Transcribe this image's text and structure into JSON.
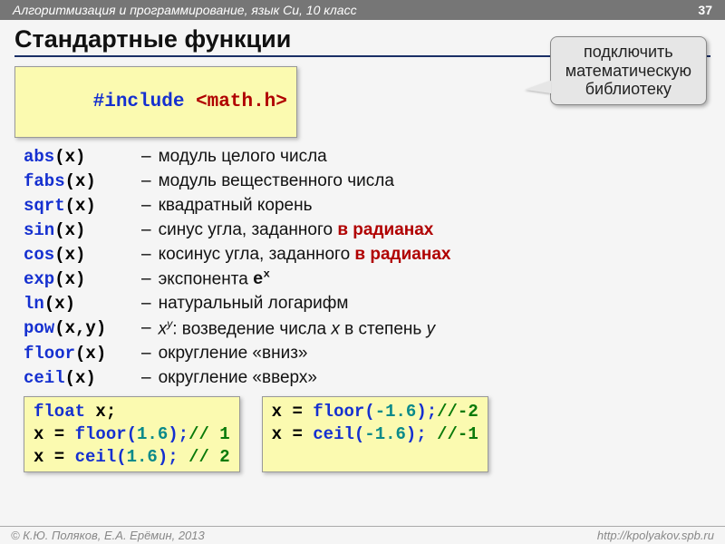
{
  "header": {
    "course": "Алгоритмизация и программирование, язык Си, 10 класс",
    "page": "37"
  },
  "title": "Стандартные функции",
  "include": {
    "directive": "#include",
    "header": "<math.h>"
  },
  "callout": {
    "l1": "подключить",
    "l2": "математическую",
    "l3": "библиотеку"
  },
  "funcs": [
    {
      "name": "abs",
      "args": "(x)",
      "desc": "модуль целого числа"
    },
    {
      "name": "fabs",
      "args": "(x)",
      "desc": "модуль вещественного числа"
    },
    {
      "name": "sqrt",
      "args": "(x)",
      "desc": "квадратный корень"
    },
    {
      "name": "sin",
      "args": "(x)",
      "desc_pre": "синус угла, заданного ",
      "em": "в радианах"
    },
    {
      "name": "cos",
      "args": "(x)",
      "desc_pre": "косинус угла, заданного ",
      "em": "в радианах"
    },
    {
      "name": "exp",
      "args": "(x)",
      "desc_pre": "экспонента ",
      "mono": "e",
      "sup": "x"
    },
    {
      "name": "ln",
      "args": "(x)",
      "desc": "натуральный логарифм"
    },
    {
      "name": "pow",
      "args": "(x,y)",
      "it1": "x",
      "sup": "y",
      "desc_post": ": возведение числа ",
      "it2": "x",
      "desc_post2": " в степень ",
      "it3": "y"
    },
    {
      "name": "floor",
      "args": "(x)",
      "desc": "округление «вниз»"
    },
    {
      "name": "ceil",
      "args": "(x)",
      "desc": "округление «вверх»"
    }
  ],
  "ex1": {
    "l1a": "float",
    "l1b": " x;",
    "l2a": "x = ",
    "l2b": "floor(",
    "l2c": "1.6",
    "l2d": ");",
    "l2e": "// 1",
    "l3a": "x = ",
    "l3b": "ceil(",
    "l3c": "1.6",
    "l3d": "); ",
    "l3e": "// 2"
  },
  "ex2": {
    "l2a": "x = ",
    "l2b": "floor(",
    "l2c": "-1.6",
    "l2d": ");",
    "l2e": "//-2",
    "l3a": "x = ",
    "l3b": "ceil(",
    "l3c": "-1.6",
    "l3d": "); ",
    "l3e": "//-1"
  },
  "footer": {
    "left": "© К.Ю. Поляков, Е.А. Ерёмин, 2013",
    "right": "http://kpolyakov.spb.ru"
  }
}
